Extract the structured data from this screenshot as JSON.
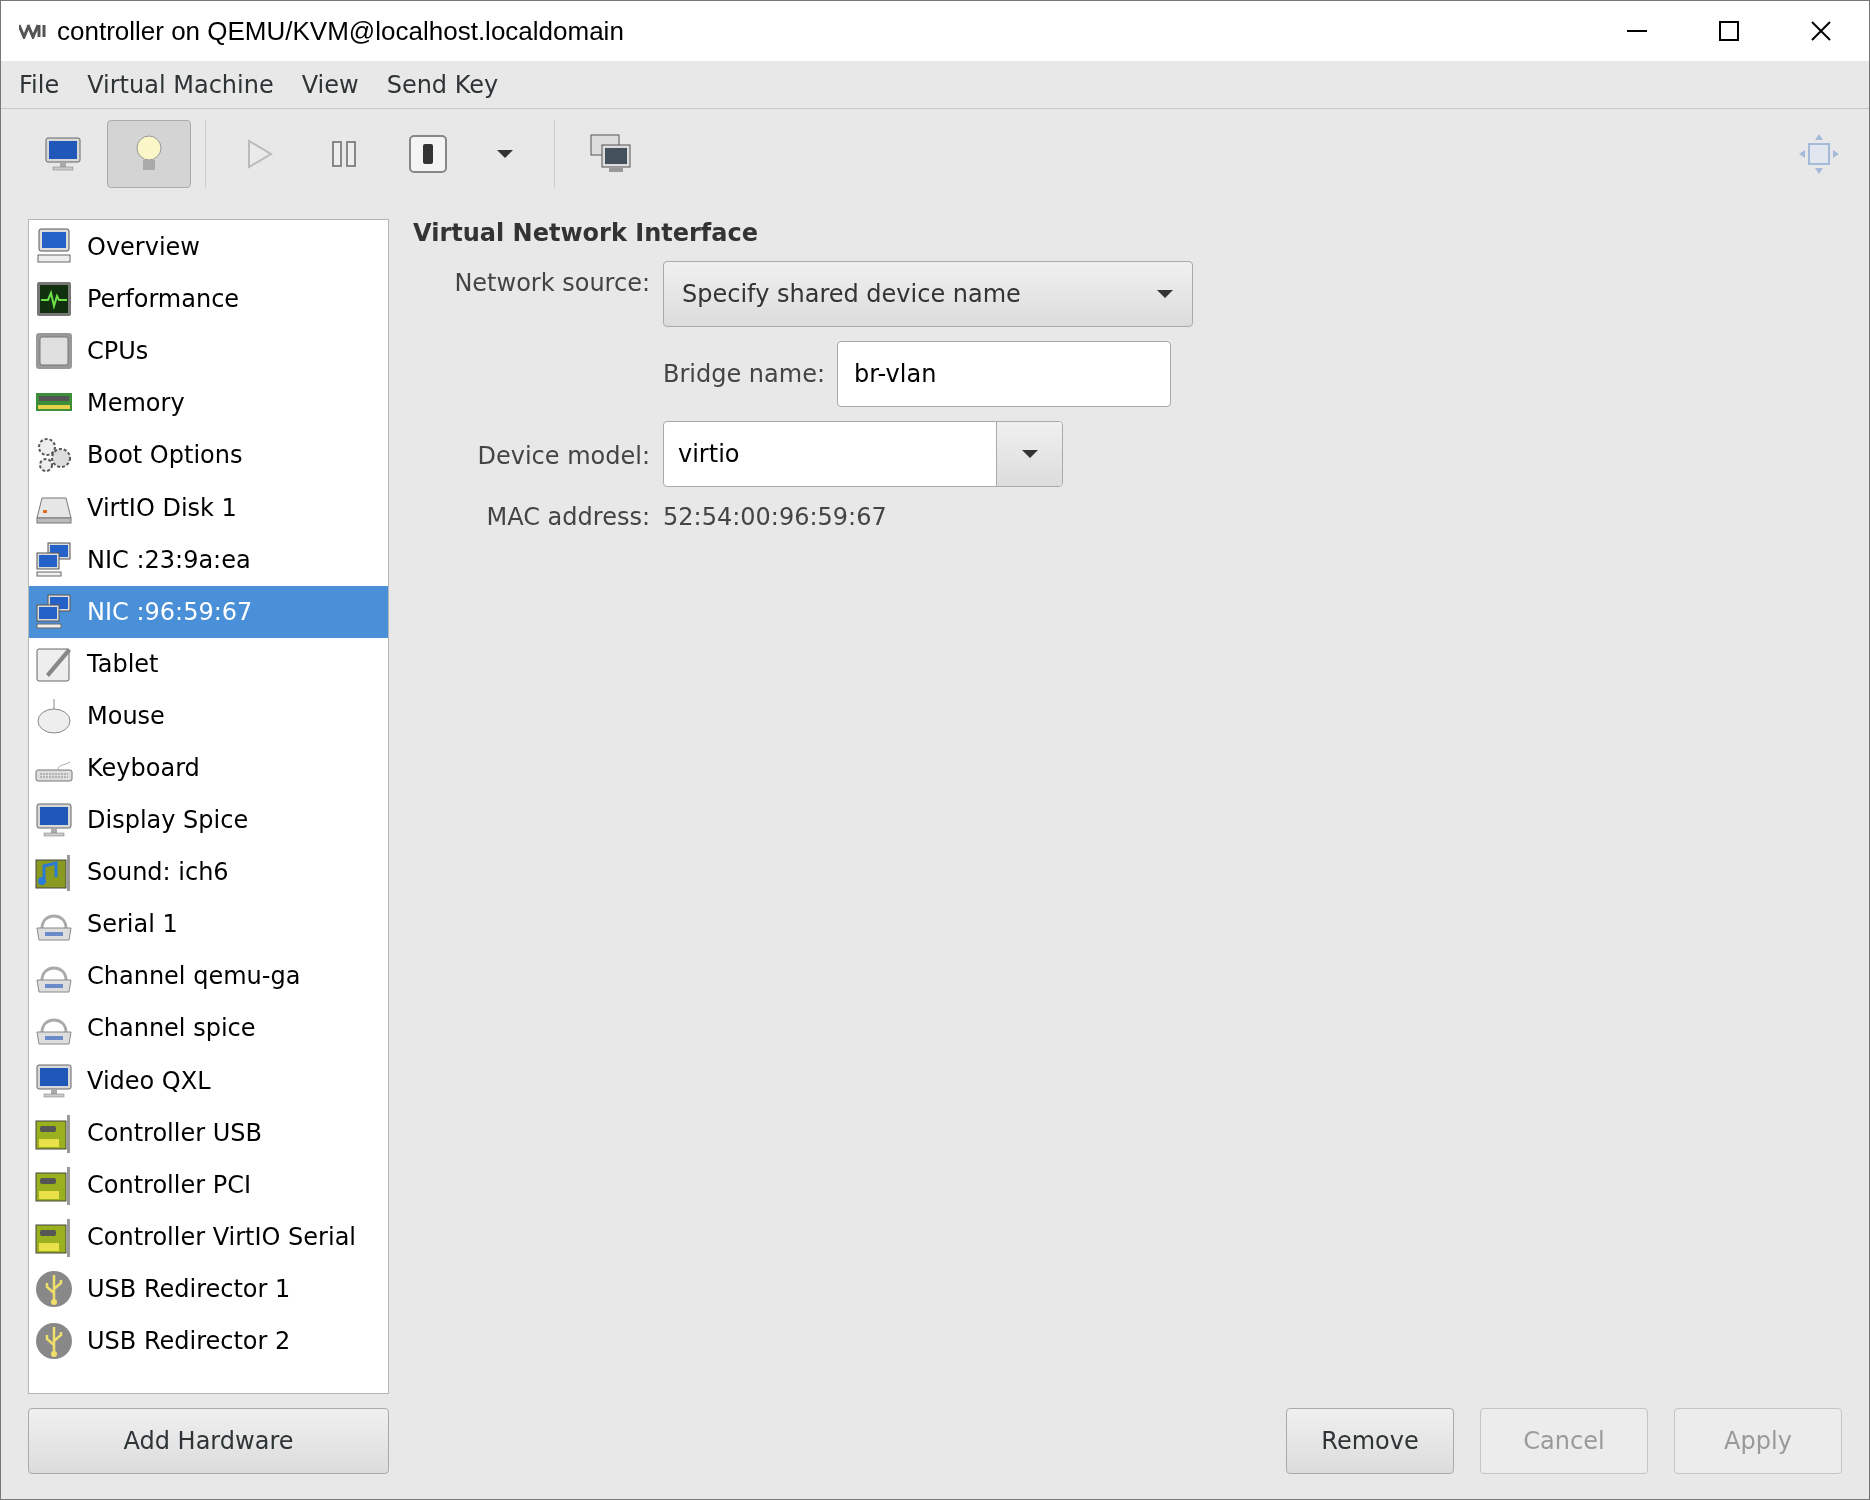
{
  "window": {
    "title": "controller on QEMU/KVM@localhost.localdomain"
  },
  "menu": [
    "File",
    "Virtual Machine",
    "View",
    "Send Key"
  ],
  "toolbar": {
    "view_buttons": [
      {
        "kind": "console",
        "selected": false
      },
      {
        "kind": "details",
        "selected": true
      }
    ],
    "run_disabled": true
  },
  "sidebar": {
    "items": [
      {
        "label": "Overview",
        "kind": "overview",
        "selected": false
      },
      {
        "label": "Performance",
        "kind": "performance",
        "selected": false
      },
      {
        "label": "CPUs",
        "kind": "cpu",
        "selected": false
      },
      {
        "label": "Memory",
        "kind": "memory",
        "selected": false
      },
      {
        "label": "Boot Options",
        "kind": "boot",
        "selected": false
      },
      {
        "label": "VirtIO Disk 1",
        "kind": "disk",
        "selected": false
      },
      {
        "label": "NIC :23:9a:ea",
        "kind": "nic",
        "selected": false
      },
      {
        "label": "NIC :96:59:67",
        "kind": "nic",
        "selected": true
      },
      {
        "label": "Tablet",
        "kind": "tablet",
        "selected": false
      },
      {
        "label": "Mouse",
        "kind": "mouse",
        "selected": false
      },
      {
        "label": "Keyboard",
        "kind": "keyboard",
        "selected": false
      },
      {
        "label": "Display Spice",
        "kind": "display",
        "selected": false
      },
      {
        "label": "Sound: ich6",
        "kind": "sound",
        "selected": false
      },
      {
        "label": "Serial 1",
        "kind": "serial",
        "selected": false
      },
      {
        "label": "Channel qemu-ga",
        "kind": "serial",
        "selected": false
      },
      {
        "label": "Channel spice",
        "kind": "serial",
        "selected": false
      },
      {
        "label": "Video QXL",
        "kind": "display",
        "selected": false
      },
      {
        "label": "Controller USB",
        "kind": "controller",
        "selected": false
      },
      {
        "label": "Controller PCI",
        "kind": "controller",
        "selected": false
      },
      {
        "label": "Controller VirtIO Serial",
        "kind": "controller",
        "selected": false
      },
      {
        "label": "USB Redirector 1",
        "kind": "usb",
        "selected": false
      },
      {
        "label": "USB Redirector 2",
        "kind": "usb",
        "selected": false
      }
    ],
    "add_button": "Add Hardware"
  },
  "details": {
    "heading": "Virtual Network Interface",
    "network_source": {
      "label": "Network source:",
      "value": "Specify shared device name"
    },
    "bridge_name": {
      "label": "Bridge name:",
      "value": "br-vlan"
    },
    "device_model": {
      "label": "Device model:",
      "value": "virtio"
    },
    "mac_address": {
      "label": "MAC address:",
      "value": "52:54:00:96:59:67"
    }
  },
  "buttons": [
    {
      "label": "Remove",
      "disabled": false
    },
    {
      "label": "Cancel",
      "disabled": true
    },
    {
      "label": "Apply",
      "disabled": true
    }
  ]
}
